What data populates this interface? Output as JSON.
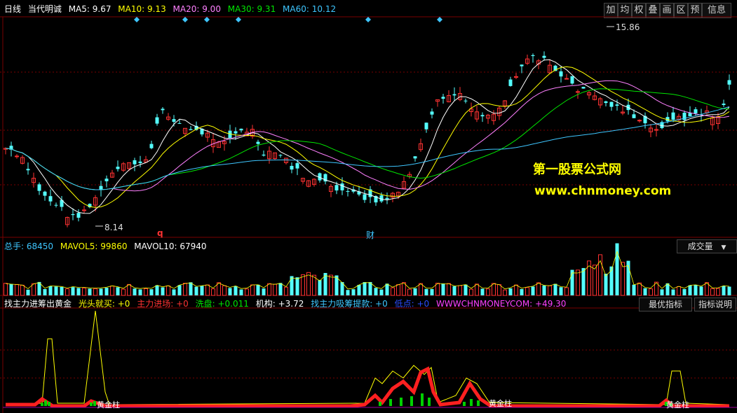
{
  "header": {
    "period": "日线",
    "name": "当代明诚",
    "ma5": "MA5: 9.67",
    "ma10": "MA10: 9.13",
    "ma20": "MA20: 9.00",
    "ma30": "MA30: 9.31",
    "ma60": "MA60: 10.12"
  },
  "toolbar": [
    "加",
    "均",
    "权",
    "叠",
    "画",
    "区",
    "预",
    "信息"
  ],
  "price_labels": {
    "high": "15.86",
    "low": "8.14",
    "q_marker": "q",
    "cai_marker": "财"
  },
  "volume": {
    "total": "总手: 68450",
    "mavol5": "MAVOL5: 99860",
    "mavol10": "MAVOL10: 67940",
    "tab": "成交量"
  },
  "indicator": {
    "name": "找主力进筹出黄金",
    "f1": "光头就买: +0",
    "f2": "主力进场: +0",
    "f3": "洗盘: +0.011",
    "f4": "机构: +3.72",
    "f5": "找主力吸筹提款: +0",
    "f6": "低点: +0",
    "f7": "WWWCHNMONEYCOM: +49.30",
    "tab_best": "最优指标",
    "tab_desc": "指标说明",
    "gold_label": "黄金柱"
  },
  "watermark": {
    "line1": "第一股票公式网",
    "line2": "www.chnmoney.com"
  },
  "colors": {
    "bg": "#000000",
    "up": "#ff3232",
    "down": "#54ffff",
    "ma5": "#ffffff",
    "ma10": "#ffff00",
    "ma20": "#ff80ff",
    "ma30": "#00e600",
    "ma60": "#3ec6ff",
    "grid": "#7a0000",
    "header_text": "#ffffff"
  }
}
